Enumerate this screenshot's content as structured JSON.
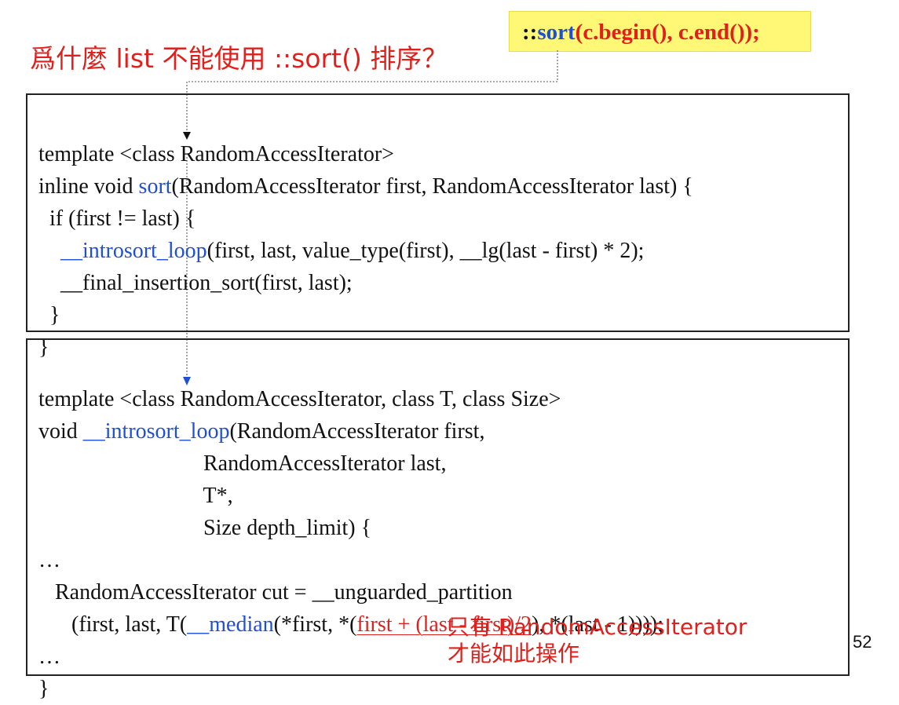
{
  "title": "爲什麼 list 不能使用 ::sort() 排序？",
  "call": {
    "prefix": "::",
    "func": "sort",
    "args": "(c.begin(), c.end());"
  },
  "box1": {
    "l1": "template <class RandomAccessIterator>",
    "l2_a": "inline void ",
    "l2_func": "sort",
    "l2_b": "(RandomAccessIterator first, RandomAccessIterator last) {",
    "l3": "  if (first != last) {",
    "l4_indent": "    ",
    "l4_func": "__introsort_loop",
    "l4_b": "(first, last, value_type(first), __lg(last - first) * 2);",
    "l5": "    __final_insertion_sort(first, last);",
    "l6": "  }",
    "l7": "}"
  },
  "box2": {
    "l1": "template <class RandomAccessIterator, class T, class Size>",
    "l2_a": "void ",
    "l2_func": "__introsort_loop",
    "l2_b": "(RandomAccessIterator first,",
    "l3": "                              RandomAccessIterator last,",
    "l4": "                              T*,",
    "l5": "                              Size depth_limit) {",
    "l6": "…",
    "l7": "   RandomAccessIterator cut = __unguarded_partition",
    "l8_a": "      (first, last, T(",
    "l8_func": "__median",
    "l8_b": "(*first, *(",
    "l8_red": "first + (last - first)/2",
    "l8_c": "), *(last - 1))));",
    "l9": "…",
    "l10": "}"
  },
  "note": {
    "line1": "只有 RandomAccessIterator",
    "line2": "才能如此操作"
  },
  "page_number": "52"
}
